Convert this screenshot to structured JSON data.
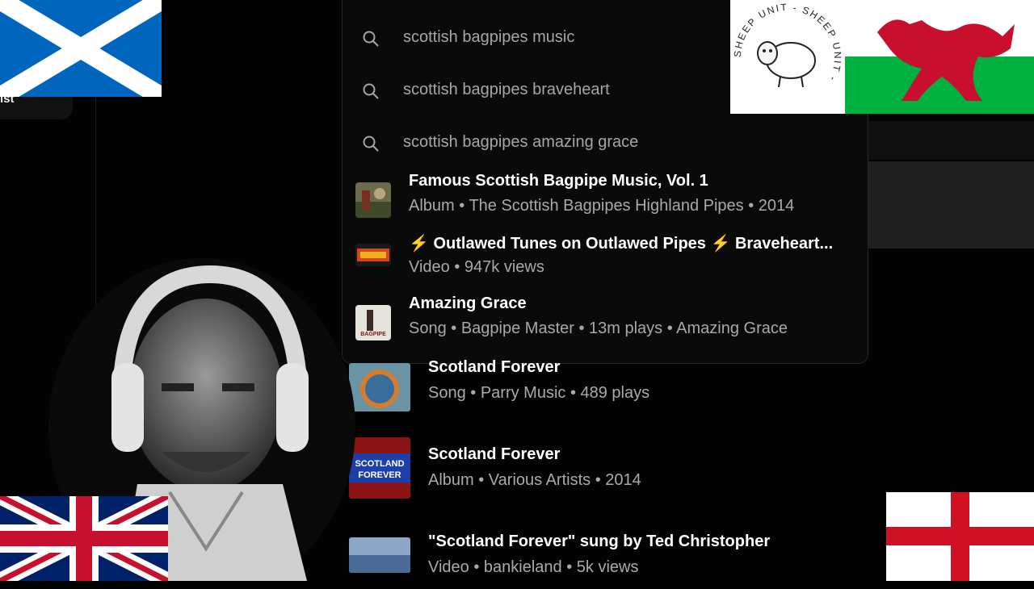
{
  "nav": {
    "pill_label": "ist"
  },
  "search": {
    "suggestions": [
      {
        "text": "scottish bagpipes music",
        "icon": "search-icon"
      },
      {
        "text": "scottish bagpipes braveheart",
        "icon": "search-icon"
      },
      {
        "text": "scottish bagpipes amazing grace",
        "icon": "search-icon"
      }
    ],
    "results": [
      {
        "title": "Famous Scottish Bagpipe Music, Vol. 1",
        "subtitle": "Album • The Scottish Bagpipes Highland Pipes • 2014"
      },
      {
        "title_prefix": "⚡",
        "title_mid": "Outlawed Tunes on Outlawed Pipes",
        "title_suffix": "Braveheart...",
        "subtitle": "Video • 947k views"
      },
      {
        "title": "Amazing Grace",
        "subtitle": "Song • Bagpipe Master • 13m plays • Amazing Grace",
        "thumb_label": "BAGPIPE"
      }
    ]
  },
  "list": [
    {
      "title": "Scotland Forever",
      "subtitle": "Song • Parry Music • 489 plays"
    },
    {
      "title": "Scotland Forever",
      "subtitle": "Album • Various Artists • 2014",
      "thumb_text": "SCOTLAND FOREVER"
    },
    {
      "title": "\"Scotland Forever\" sung by Ted Christopher",
      "subtitle": "Video • bankieland • 5k views"
    }
  ],
  "overlays": {
    "sheep_logo_text": "SHEEP UNIT - SHEEP UNIT -",
    "flags": [
      "scotland-flag",
      "wales-flag",
      "uk-flag",
      "england-flag"
    ]
  },
  "colors": {
    "background": "#030303",
    "dropdown": "#0a0a0a",
    "muted_text": "#aaaaaa",
    "bolt": "#f26c1f",
    "scotland_blue": "#0065bd",
    "wales_green": "#00b140",
    "wales_red": "#c8102e",
    "england_red": "#ce1124",
    "uk_blue": "#012169"
  }
}
